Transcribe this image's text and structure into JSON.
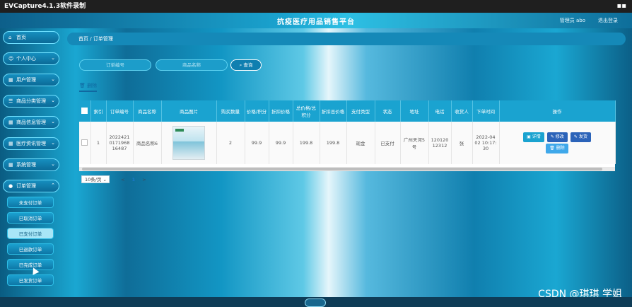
{
  "window": {
    "app_title": "EVCapture4.1.3软件录制",
    "controls_icon": "window-controls-icon"
  },
  "header": {
    "title": "抗疫医疗用品销售平台",
    "user": "管理员 abo",
    "logout": "退出登录"
  },
  "sidebar": {
    "items": [
      {
        "label": "首页",
        "icon": "home-icon",
        "glyph": "⌂"
      },
      {
        "label": "个人中心",
        "icon": "user-icon",
        "glyph": "☺"
      },
      {
        "label": "用户管理",
        "icon": "grid-icon",
        "glyph": "▦"
      },
      {
        "label": "商品分类管理",
        "icon": "list-icon",
        "glyph": "☰"
      },
      {
        "label": "商品信息管理",
        "icon": "grid-icon",
        "glyph": "▦"
      },
      {
        "label": "医疗资讯管理",
        "icon": "grid-icon",
        "glyph": "▦"
      },
      {
        "label": "系统管理",
        "icon": "grid-icon",
        "glyph": "▦"
      },
      {
        "label": "订单管理",
        "icon": "order-icon",
        "glyph": "●"
      }
    ],
    "order_submenu": [
      "未支付订单",
      "已取消订单",
      "已支付订单",
      "已退款订单",
      "已完成订单",
      "已发货订单"
    ],
    "active_submenu_index": 4
  },
  "breadcrumb": {
    "home": "首页",
    "sep": "/",
    "current": "订单管理"
  },
  "search": {
    "order_no_placeholder": "订单编号",
    "product_name_placeholder": "商品名称",
    "query_label": "查询",
    "query_icon": "search-icon"
  },
  "toolbar": {
    "delete_label": "删除"
  },
  "table": {
    "headers": [
      "索引",
      "订单编号",
      "商品名称",
      "商品图片",
      "购买数量",
      "价格/积分",
      "折扣价格",
      "总价格/总积分",
      "折扣总价格",
      "支付类型",
      "状态",
      "地址",
      "电话",
      "收货人",
      "下单时间",
      "操作"
    ],
    "rows": [
      {
        "index": "1",
        "order_no": "20224210171968 16487",
        "product_name": "商品名称6",
        "image_icon": "product-image",
        "quantity": "2",
        "price": "99.9",
        "discount_price": "99.9",
        "total": "199.8",
        "discount_total": "199.8",
        "pay_type": "现金",
        "status": "已支付",
        "address": "广州天河5号",
        "phone": "12012012312",
        "receiver": "张",
        "time": "2022-04 02 10:17:30"
      }
    ],
    "actions": {
      "detail": "详情",
      "edit": "修改",
      "ship": "发货",
      "delete": "删除"
    }
  },
  "pagination": {
    "page_size": "10条/页",
    "prev": "<",
    "current": "1",
    "next": ">"
  },
  "watermark": "CSDN @琪琪 学姐"
}
